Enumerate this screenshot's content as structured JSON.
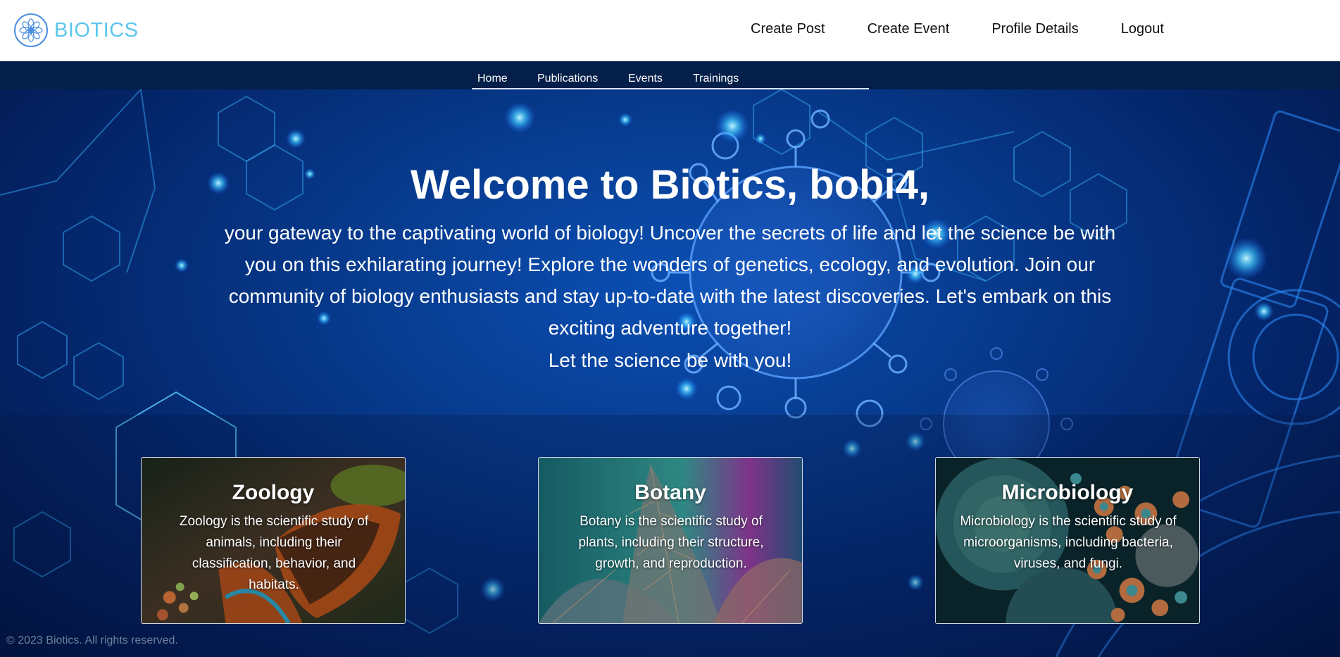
{
  "header": {
    "brand": {
      "icon": "flower-logo-icon",
      "name": "BIOTICS",
      "color": "#5cc6ec"
    },
    "nav": [
      {
        "label": "Create Post"
      },
      {
        "label": "Create Event"
      },
      {
        "label": "Profile Details"
      },
      {
        "label": "Logout"
      }
    ]
  },
  "subnav": {
    "background": "#04204a",
    "items": [
      {
        "label": "Home"
      },
      {
        "label": "Publications"
      },
      {
        "label": "Events"
      },
      {
        "label": "Trainings"
      }
    ]
  },
  "hero": {
    "welcome_prefix": "Welcome to Biotics, ",
    "username": "bobi4,",
    "intro": "your gateway to the captivating world of biology! Uncover the secrets of life and let the science be with you on this exhilarating journey! Explore the wonders of genetics, ecology, and evolution. Join our community of biology enthusiasts and stay up-to-date with the latest discoveries. Let's embark on this exciting adventure together!",
    "motto": "Let the science be with you!"
  },
  "cards": [
    {
      "title": "Zoology",
      "text": "Zoology is the scientific study of animals, including their classification, behavior, and habitats.",
      "image": "butterfly-image"
    },
    {
      "title": "Botany",
      "text": "Botany is the scientific study of plants, including their structure, growth, and reproduction.",
      "image": "leaf-image"
    },
    {
      "title": "Microbiology",
      "text": "Microbiology is the scientific study of microorganisms, including bacteria, viruses, and fungi.",
      "image": "microorganisms-image"
    }
  ],
  "footer": {
    "text": "© 2023 Biotics. All rights reserved."
  }
}
